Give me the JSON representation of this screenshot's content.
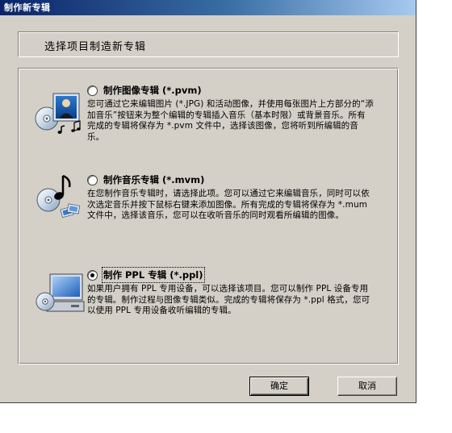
{
  "window": {
    "title": "制作新专辑"
  },
  "header": {
    "instruction": "选择项目制造新专辑"
  },
  "options": [
    {
      "title": "制作图像专辑 (*.pvm)",
      "description": "您可通过它来编辑图片 (*.JPG) 和活动图像，并使用每张图片上方部分的“添加音乐”按钮来为整个编辑的专辑插入音乐（基本时限）或背景音乐。所有完成的专辑将保存为 *.pvm 文件中，选择该图像，您将听到所编辑的音乐。",
      "icon": "photo-album-icon",
      "selected": false
    },
    {
      "title": "制作音乐专辑 (*.mvm)",
      "description": "在您制作音乐专辑时，请选择此项。您可以通过它来编辑音乐，同时可以依次选定音乐并按下鼠标右键来添加图像。所有完成的专辑将保存为 *.mum 文件中，选择该音乐，您可以在收听音乐的同时观看所编辑的图像。",
      "icon": "music-album-icon",
      "selected": false
    },
    {
      "title": "制作 PPL 专辑 (*.ppl)",
      "description": "如果用户拥有 PPL 专用设备，可以选择该项目。您可以制作 PPL 设备专用的专辑。制作过程与图像专辑类似。完成的专辑将保存为 *.ppl 格式，您可以使用 PPL 专用设备收听编辑的专辑。",
      "icon": "ppl-device-icon",
      "selected": true
    }
  ],
  "buttons": {
    "ok": "确定",
    "cancel": "取消"
  }
}
